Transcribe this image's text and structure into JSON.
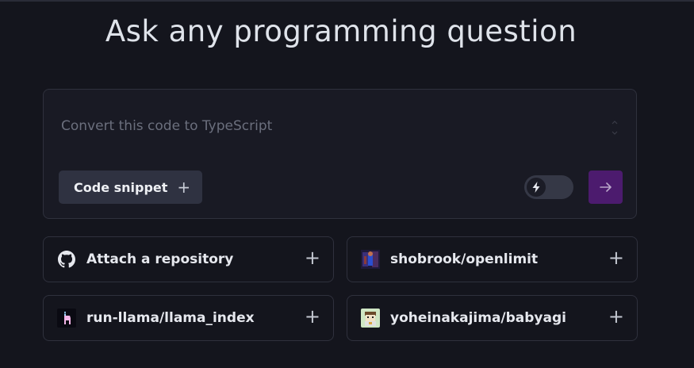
{
  "header": {
    "title": "Ask any programming question"
  },
  "composer": {
    "placeholder": "Convert this code to TypeScript",
    "snippet_label": "Code snippet",
    "snippet_plus": "+"
  },
  "repos": [
    {
      "label": "Attach a repository",
      "icon": "github-icon",
      "plus": "+"
    },
    {
      "label": "shobrook/openlimit",
      "icon": "avatar-image",
      "plus": "+"
    },
    {
      "label": "run-llama/llama_index",
      "icon": "llama-avatar",
      "plus": "+"
    },
    {
      "label": "yoheinakajima/babyagi",
      "icon": "babyagi-avatar",
      "plus": "+"
    }
  ],
  "colors": {
    "background": "#14151d",
    "send_button": "#4c1b6e",
    "snippet_button": "#2f3241"
  }
}
